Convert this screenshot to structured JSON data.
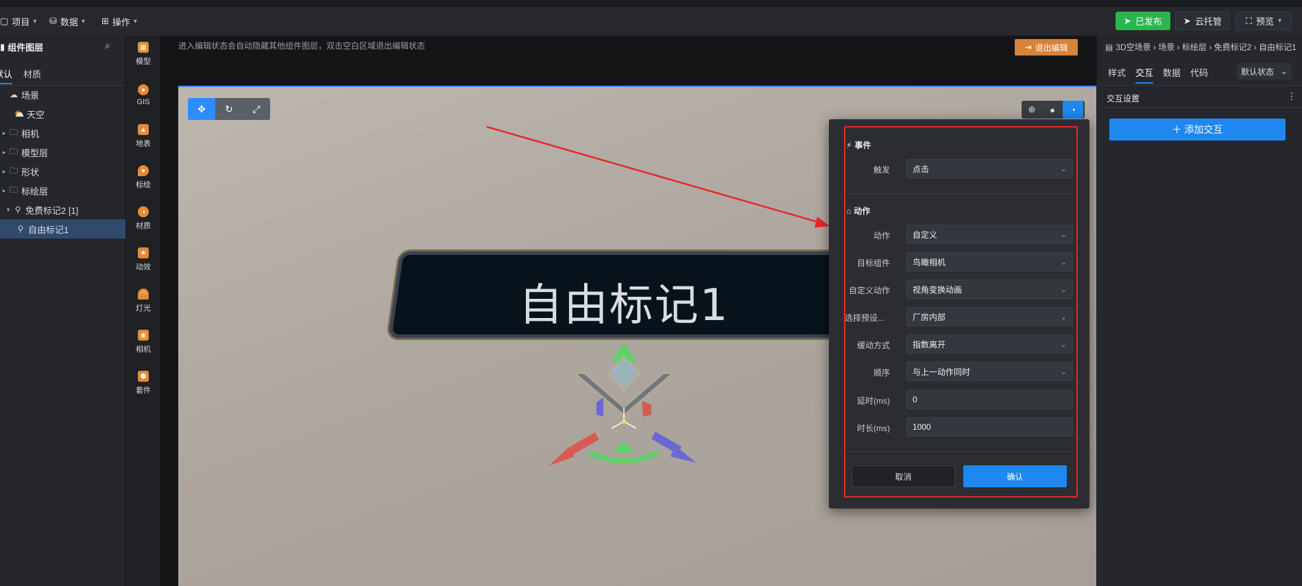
{
  "topbar": {
    "menus": [
      {
        "label": "项目"
      },
      {
        "label": "数据"
      },
      {
        "label": "操作"
      }
    ],
    "publish_label": "已发布",
    "cloud_label": "云托管",
    "preview_label": "预览"
  },
  "left_panel": {
    "title": "组件图层",
    "tabs": [
      "默认",
      "材质"
    ],
    "tree": [
      {
        "label": "场景",
        "icon": "cloud-icon"
      },
      {
        "label": "天空",
        "icon": "weather-icon"
      },
      {
        "label": "相机",
        "icon": "folder-icon"
      },
      {
        "label": "模型层",
        "icon": "folder-icon"
      },
      {
        "label": "形状",
        "icon": "folder-icon"
      },
      {
        "label": "标绘层",
        "icon": "folder-icon"
      },
      {
        "label": "免费标记2 [1]",
        "icon": "marker-icon"
      },
      {
        "label": "自由标记1",
        "icon": "marker-icon"
      }
    ]
  },
  "icon_strip": [
    {
      "label": "模型",
      "icon": "model-icon"
    },
    {
      "label": "GIS",
      "icon": "globe-icon"
    },
    {
      "label": "地表",
      "icon": "terrain-icon"
    },
    {
      "label": "标绘",
      "icon": "pin-icon"
    },
    {
      "label": "材质",
      "icon": "material-icon"
    },
    {
      "label": "动效",
      "icon": "effect-icon"
    },
    {
      "label": "灯光",
      "icon": "light-icon"
    },
    {
      "label": "相机",
      "icon": "camera-icon"
    },
    {
      "label": "套件",
      "icon": "kit-icon"
    }
  ],
  "canvas": {
    "hint": "进入编辑状态会自动隐藏其他组件图层，双击空白区域退出编辑状态",
    "exit_label": "退出编辑",
    "marker_text": "自由标记1"
  },
  "dialog": {
    "event_section": "事件",
    "action_section": "动作",
    "fields": [
      {
        "label": "触发",
        "value": "点击"
      },
      {
        "label": "动作",
        "value": "自定义"
      },
      {
        "label": "目标组件",
        "value": "鸟瞰相机"
      },
      {
        "label": "自定义动作",
        "value": "视角变换动画"
      },
      {
        "label": "选择预设...",
        "value": "厂房内部"
      },
      {
        "label": "缓动方式",
        "value": "指数离开"
      },
      {
        "label": "顺序",
        "value": "与上一动作同时"
      },
      {
        "label": "延时(ms)",
        "value": "0"
      },
      {
        "label": "时长(ms)",
        "value": "1000"
      }
    ],
    "cancel_label": "取消",
    "confirm_label": "确认"
  },
  "right_panel": {
    "breadcrumb": "3D空场景 › 场景 › 标绘层 › 免费标记2 › 自由标记1",
    "tabs": [
      "样式",
      "交互",
      "数据",
      "代码"
    ],
    "state_label": "默认状态",
    "section_title": "交互设置",
    "add_label": "添加交互"
  },
  "colors": {
    "accent": "#1e88f0",
    "publish": "#2bb550",
    "exit": "#d9823a",
    "highlight": "#e42a2a"
  }
}
